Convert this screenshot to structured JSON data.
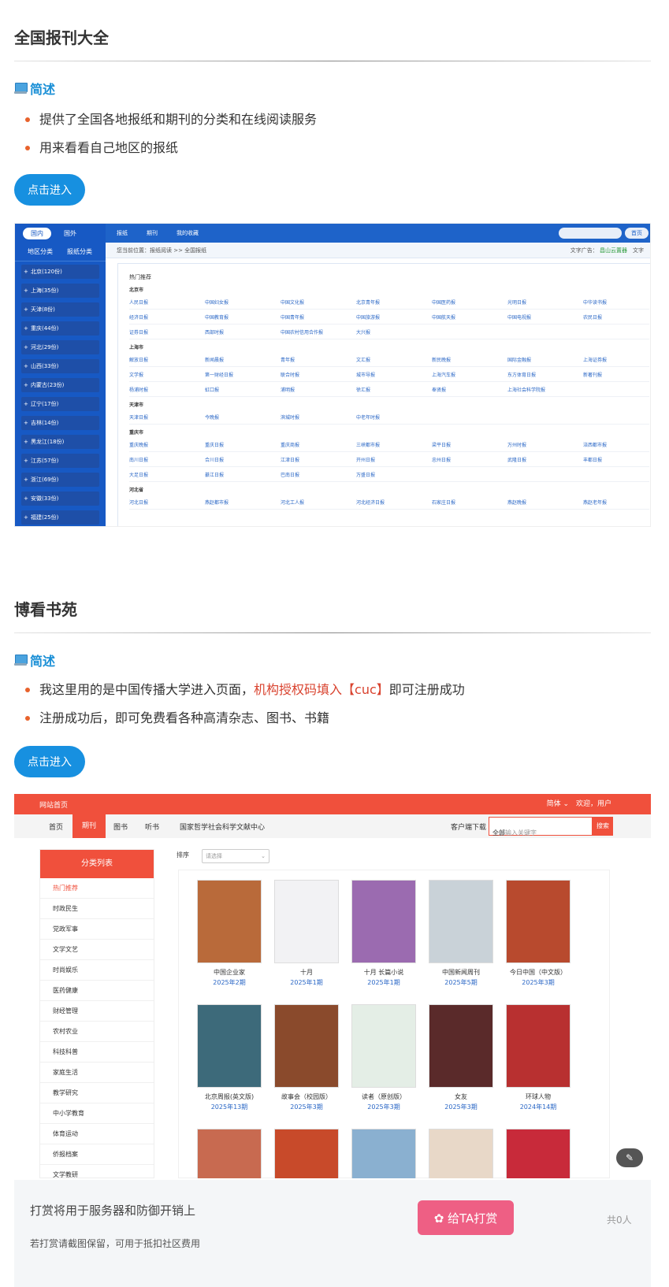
{
  "section1": {
    "title": "全国报刊大全",
    "subtitle": "简述",
    "bullets": [
      "提供了全国各地报纸和期刊的分类和在线阅读服务",
      "用来看看自己地区的报纸"
    ],
    "button": "点击进入"
  },
  "shot1": {
    "tabs": [
      "国内",
      "国外"
    ],
    "subtabs": [
      "地区分类",
      "报纸分类"
    ],
    "provinces": [
      "北京(120份)",
      "上海(35份)",
      "天津(8份)",
      "重庆(44份)",
      "河北(29份)",
      "山西(33份)",
      "内蒙古(23份)",
      "辽宁(17份)",
      "吉林(14份)",
      "黑龙江(18份)",
      "江苏(57份)",
      "浙江(69份)",
      "安徽(33份)",
      "福建(25份)"
    ],
    "topnav": [
      "报纸",
      "期刊",
      "我的收藏"
    ],
    "home": "首页",
    "crumb": "您当前位置：报纸阅读 >> 全国报纸",
    "ad": "文字广告：",
    "ad_link": "昌山云置器",
    "text_btn": "文字",
    "hot": "热门推荐",
    "cities": [
      {
        "name": "北京市",
        "rows": [
          [
            "人民日报",
            "中国妇女报",
            "中国文化报",
            "北京青年报",
            "中国医药报",
            "光明日报",
            "中华读书报"
          ],
          [
            "经济日报",
            "中国教育报",
            "中国青年报",
            "中国旅游报",
            "中国航天报",
            "中国电视报",
            "农民日报"
          ],
          [
            "证券日报",
            "西部时报",
            "中国农村信用合作报",
            "大兴报"
          ]
        ]
      },
      {
        "name": "上海市",
        "rows": [
          [
            "解放日报",
            "新闻晨报",
            "青年报",
            "文汇报",
            "新民晚报",
            "国际金融报",
            "上海证券报"
          ],
          [
            "文学报",
            "第一财经日报",
            "联合时报",
            "城市导报",
            "上海汽车报",
            "东方体育日报",
            "新著刊报"
          ],
          [
            "杨浦时报",
            "虹口报",
            "浦明报",
            "徐汇报",
            "奉贤报",
            "上海社会科学院报"
          ]
        ]
      },
      {
        "name": "天津市",
        "rows": [
          [
            "天津日报",
            "今晚报",
            "滨城时报",
            "中老年时报"
          ]
        ]
      },
      {
        "name": "重庆市",
        "rows": [
          [
            "重庆晚报",
            "重庆日报",
            "重庆商报",
            "三峡都市报",
            "梁平日报",
            "万州时报",
            "涪西都市报"
          ],
          [
            "南川日报",
            "合川日报",
            "江津日报",
            "开州日报",
            "忠州日报",
            "武隆日报",
            "丰都日报"
          ],
          [
            "大足日报",
            "綦江日报",
            "巴南日报",
            "万盛日报"
          ]
        ]
      },
      {
        "name": "河北省",
        "rows": [
          [
            "河北日报",
            "燕赵都市报",
            "河北工人报",
            "河北经济日报",
            "石家庄日报",
            "燕赵晚报",
            "燕赵老年报"
          ]
        ]
      }
    ]
  },
  "section2": {
    "title": "博看书苑",
    "subtitle": "简述",
    "bullet1_pre": "我这里用的是中国传播大学进入页面，",
    "bullet1_red": "机构授权码填入【cuc】",
    "bullet1_post": "即可注册成功",
    "bullet2": "注册成功后，即可免费看各种高清杂志、图书、书籍",
    "button": "点击进入"
  },
  "shot2": {
    "top_left": "网站首页",
    "top_right": "简体 ⌄　欢迎，用户",
    "nav": [
      "首页",
      "期刊",
      "图书",
      "听书",
      "国家哲学社会科学文献中心"
    ],
    "client": "客户端下载",
    "search_scope": "全部",
    "search_placeholder": "请输入关键字",
    "search_btn": "搜索",
    "cat_header": "分类列表",
    "categories": [
      "热门推荐",
      "时政民生",
      "党政军事",
      "文学文艺",
      "时尚娱乐",
      "医药健康",
      "财经管理",
      "农村农业",
      "科技科普",
      "家庭生活",
      "教学研究",
      "中小学教育",
      "体育运动",
      "侨报档案",
      "文学教研"
    ],
    "sort": "排序",
    "sort_placeholder": "请选择",
    "books": [
      {
        "title": "中国企业家",
        "issue": "2025年2期",
        "color": "#b96a3a"
      },
      {
        "title": "十月",
        "issue": "2025年1期",
        "color": "#f2f2f4"
      },
      {
        "title": "十月 长篇小说",
        "issue": "2025年1期",
        "color": "#9b6bb0"
      },
      {
        "title": "中国新闻周刊",
        "issue": "2025年5期",
        "color": "#c9d2d8"
      },
      {
        "title": "今日中国（中文版）",
        "issue": "2025年3期",
        "color": "#b84a2e"
      },
      {
        "title": "北京周报(英文版)",
        "issue": "2025年13期",
        "color": "#3d6a7a"
      },
      {
        "title": "故事会（校园版）",
        "issue": "2025年3期",
        "color": "#8a4a2c"
      },
      {
        "title": "读者（原创版）",
        "issue": "2025年3期",
        "color": "#e4eee6"
      },
      {
        "title": "女友",
        "issue": "2025年3期",
        "color": "#5a2a2a"
      },
      {
        "title": "环球人物",
        "issue": "2024年14期",
        "color": "#b83030"
      }
    ]
  },
  "reward": {
    "title": "打赏将用于服务器和防御开销上",
    "sub": "若打赏请截图保留，可用于抵扣社区费用",
    "button": "给TA打赏",
    "count": "共0人"
  }
}
